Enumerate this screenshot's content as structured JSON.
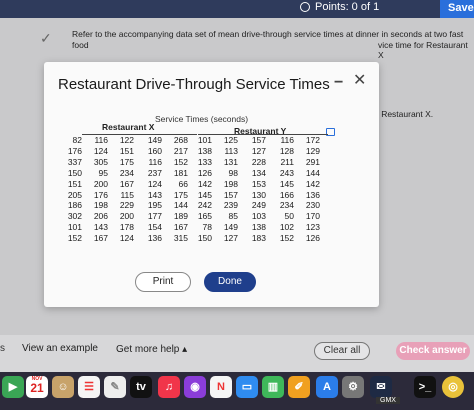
{
  "header": {
    "points_label": "Points: 0 of 1",
    "save_label": "Save"
  },
  "page": {
    "intro_line1": "Refer to the accompanying data set of mean drive-through service times at dinner in seconds at two fast food",
    "intro_line2": "vice time for Restaurant X",
    "side_text": "r Restaurant X."
  },
  "modal": {
    "title": "Restaurant Drive-Through Service Times",
    "minimize": "−",
    "close": "✕",
    "table_title": "Service Times (seconds)",
    "group_x": "Restaurant X",
    "group_y": "Restaurant Y",
    "rows": [
      [
        "82",
        "116",
        "122",
        "149",
        "268",
        "101",
        "125",
        "157",
        "116",
        "172"
      ],
      [
        "176",
        "124",
        "151",
        "160",
        "217",
        "138",
        "113",
        "127",
        "128",
        "129"
      ],
      [
        "337",
        "305",
        "175",
        "116",
        "152",
        "133",
        "131",
        "228",
        "211",
        "291"
      ],
      [
        "150",
        "95",
        "234",
        "237",
        "181",
        "126",
        "98",
        "134",
        "243",
        "144"
      ],
      [
        "151",
        "200",
        "167",
        "124",
        "66",
        "142",
        "198",
        "153",
        "145",
        "142"
      ],
      [
        "205",
        "176",
        "115",
        "143",
        "175",
        "145",
        "157",
        "130",
        "166",
        "136"
      ],
      [
        "186",
        "198",
        "229",
        "195",
        "144",
        "242",
        "239",
        "249",
        "234",
        "230"
      ],
      [
        "302",
        "206",
        "200",
        "177",
        "189",
        "165",
        "85",
        "103",
        "50",
        "170"
      ],
      [
        "101",
        "143",
        "178",
        "154",
        "167",
        "78",
        "149",
        "138",
        "102",
        "123"
      ],
      [
        "152",
        "167",
        "124",
        "136",
        "315",
        "150",
        "127",
        "183",
        "152",
        "126"
      ]
    ],
    "print_label": "Print",
    "done_label": "Done"
  },
  "footer": {
    "partial_label": "s",
    "example_label": "View an example",
    "help_label": "Get more help ▴",
    "clear_label": "Clear all",
    "check_label": "Check answer"
  },
  "dock": {
    "calendar_month": "NOV",
    "calendar_day": "21",
    "tv_label": "tv",
    "gmx_label": "GMX"
  }
}
